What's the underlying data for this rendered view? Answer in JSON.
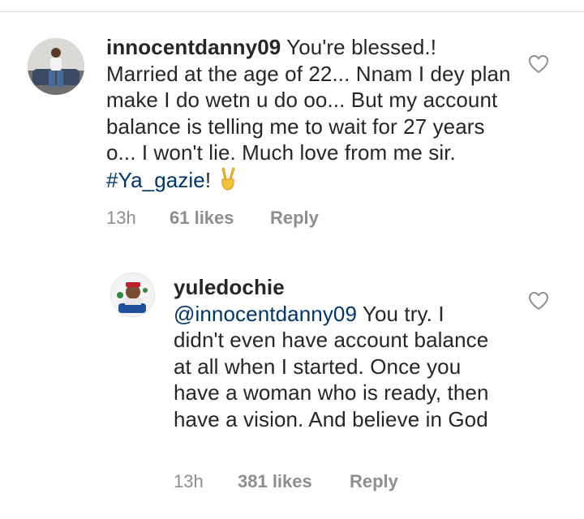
{
  "comments": [
    {
      "username": "innocentdanny09",
      "text_lead": " You're blessed.! Married at the age of 22... Nnam I dey plan make I do wetn u do oo... But my account balance is telling me to wait for 27 years o... I won't lie. Much  love from me sir. ",
      "hashtag": "#Ya_gazie",
      "text_tail": "! ",
      "emoji_icon": "victory-hand-icon",
      "time": "13h",
      "likes": "61 likes",
      "reply_label": "Reply"
    },
    {
      "username": "yuledochie",
      "mention": "@innocentdanny09",
      "text": " You try. I didn't even have account balance at all when I started. Once you have a woman who is ready, then have a vision. And believe in God",
      "time": "13h",
      "likes": "381 likes",
      "reply_label": "Reply"
    }
  ],
  "colors": {
    "text": "#262626",
    "meta": "#8e8e8e",
    "link": "#003569",
    "divider": "#dbdbdb"
  }
}
